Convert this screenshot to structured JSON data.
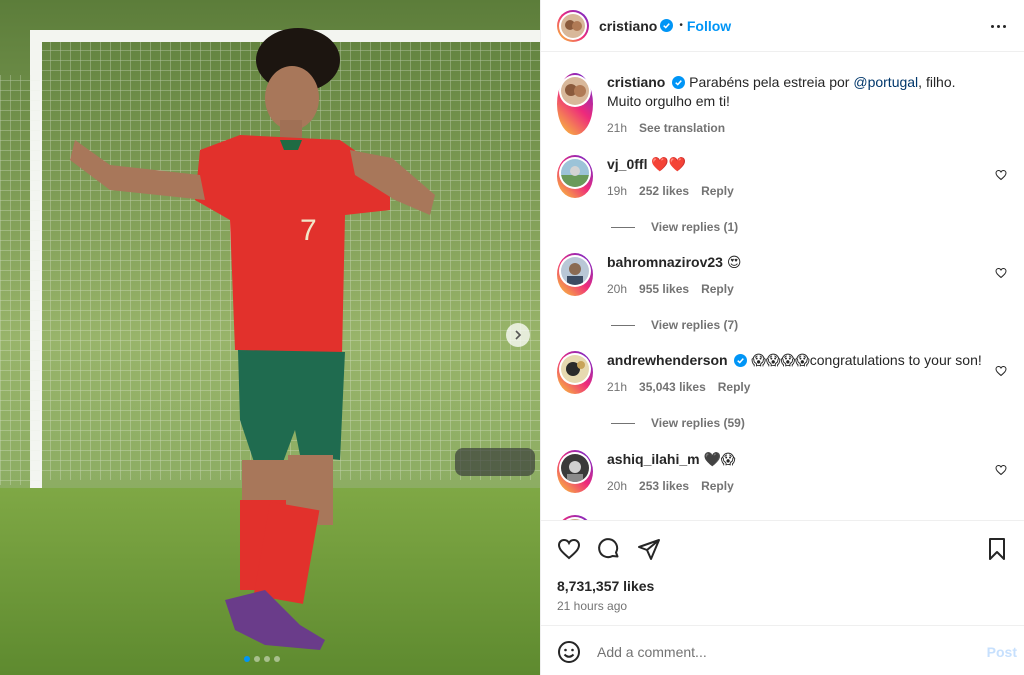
{
  "header": {
    "username": "cristiano",
    "follow_label": "Follow",
    "separator": "•"
  },
  "caption": {
    "username": "cristiano",
    "text_before": "Parabéns pela estreia por ",
    "mention": "@portugal",
    "text_after": ", filho. Muito orgulho em ti!",
    "time": "21h",
    "see_translation": "See translation"
  },
  "comments": [
    {
      "username": "vj_0ffl",
      "text": "❤️❤️",
      "time": "19h",
      "likes": "252 likes",
      "reply_label": "Reply",
      "view_replies": "View replies (1)",
      "verified": false
    },
    {
      "username": "bahromnazirov23",
      "text": "😍",
      "time": "20h",
      "likes": "955 likes",
      "reply_label": "Reply",
      "view_replies": "View replies (7)",
      "verified": false
    },
    {
      "username": "andrewhenderson",
      "text": "😱😱😱😱congratulations to your son!",
      "time": "21h",
      "likes": "35,043 likes",
      "reply_label": "Reply",
      "view_replies": "View replies (59)",
      "verified": true
    },
    {
      "username": "ashiq_ilahi_m",
      "text": "🖤😱",
      "time": "20h",
      "likes": "253 likes",
      "reply_label": "Reply",
      "verified": false
    }
  ],
  "post_stats": {
    "likes": "8,731,357 likes",
    "time_ago": "21 hours ago"
  },
  "add_comment": {
    "placeholder": "Add a comment...",
    "post_label": "Post"
  },
  "icons": {
    "like": "heart-icon",
    "comment": "comment-icon",
    "share": "share-icon",
    "save": "bookmark-icon",
    "emoji": "emoji-icon",
    "more": "more-options-icon",
    "next": "chevron-right-icon",
    "verified": "verified-badge-icon"
  },
  "colors": {
    "accent": "#0095f6",
    "text": "#262626",
    "secondary": "#737373",
    "mention": "#00376b",
    "post_disabled": "#c7e0fd"
  },
  "carousel": {
    "slide_count": 4,
    "active_index": 0
  }
}
